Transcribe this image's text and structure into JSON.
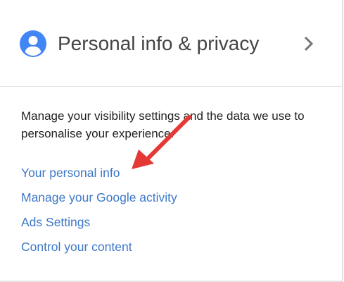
{
  "card": {
    "title": "Personal info & privacy",
    "description": "Manage your visibility settings and the data we use to personalise your experience.",
    "links": [
      "Your personal info",
      "Manage your Google activity",
      "Ads Settings",
      "Control your content"
    ]
  },
  "icons": {
    "avatar": "account-circle-icon",
    "chevron": "chevron-right-icon",
    "annotation": "red-arrow-annotation"
  },
  "colors": {
    "avatar_blue": "#4285f4",
    "link_blue": "#3d78c7",
    "arrow_red": "#e53935",
    "title_gray": "#444444"
  }
}
